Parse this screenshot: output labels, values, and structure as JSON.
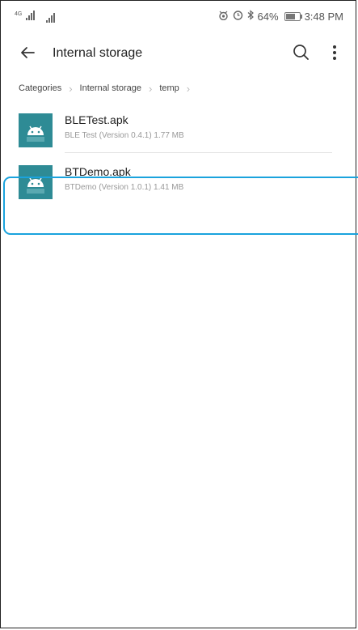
{
  "status_bar": {
    "network_label": "4G",
    "battery_text": "64%",
    "time": "3:48 PM"
  },
  "header": {
    "title": "Internal storage"
  },
  "breadcrumb": [
    "Categories",
    "Internal storage",
    "temp"
  ],
  "files": [
    {
      "name": "BLETest.apk",
      "meta": "BLE Test (Version 0.4.1) 1.77 MB",
      "icon": "android-apk-icon"
    },
    {
      "name": "BTDemo.apk",
      "meta": "BTDemo (Version 1.0.1) 1.41 MB",
      "icon": "android-apk-icon"
    }
  ],
  "colors": {
    "icon_bg": "#2e8b95",
    "highlight": "#1aa3dd"
  }
}
